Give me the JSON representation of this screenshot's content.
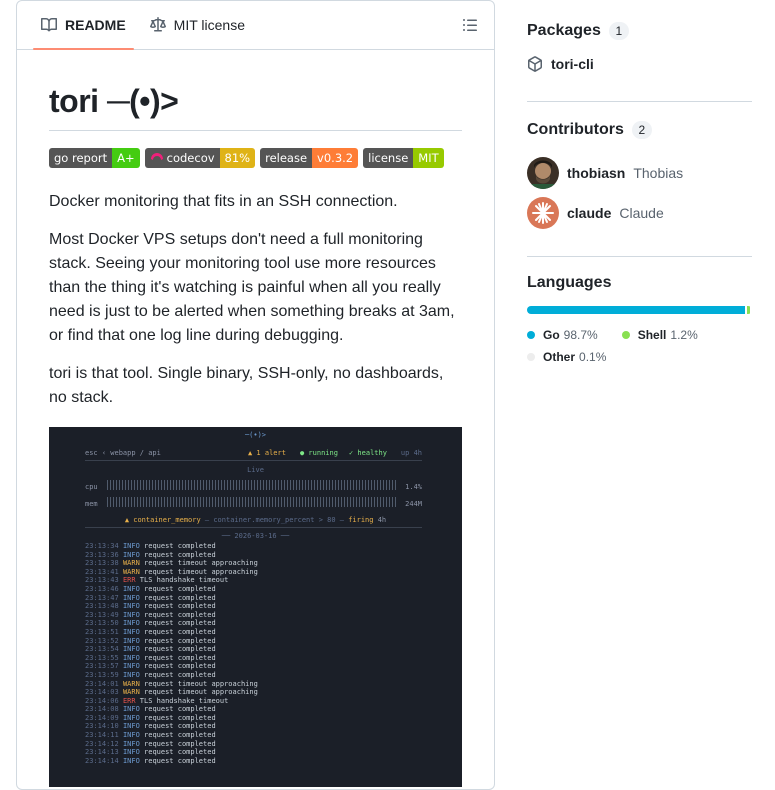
{
  "tabs": [
    {
      "label": "README",
      "icon": "book-icon"
    },
    {
      "label": "MIT license",
      "icon": "law-icon"
    }
  ],
  "readme": {
    "title": "tori ─(•)>",
    "badges": [
      {
        "left": "go report",
        "right": "A+",
        "color": "#4c1"
      },
      {
        "left": "codecov",
        "right": "81%",
        "color": "#dfb317"
      },
      {
        "left": "release",
        "right": "v0.3.2",
        "color": "#fe7d37"
      },
      {
        "left": "license",
        "right": "MIT",
        "color": "#97ca00"
      }
    ],
    "paragraphs": [
      "Docker monitoring that fits in an SSH connection.",
      "Most Docker VPS setups don't need a full monitoring stack. Seeing your monitoring tool use more resources than the thing it's watching is painful when all you really need is just to be alerted when something breaks at 3am, or find that one log line during debugging.",
      "tori is that tool. Single binary, SSH-only, no dashboards, no stack."
    ],
    "terminal": {
      "logo": "─(•)>",
      "breadcrumb": "esc ‹ webapp / api",
      "status_alert": "▲ 1 alert",
      "status_running": "● running",
      "status_healthy": "✓ healthy",
      "status_uptime": "up 4h",
      "live_label": "Live",
      "cpu_label": "cpu",
      "cpu_value": "1.4%",
      "mem_label": "mem",
      "mem_value": "244M",
      "alert_name": "▲ container_memory",
      "alert_rule": "— container.memory_percent > 80 —",
      "alert_state": "firing",
      "alert_age": "4h",
      "date_sep": "── 2026-03-16 ──",
      "logs": [
        {
          "t": "23:13:34",
          "lvl": "INFO",
          "msg": "request completed"
        },
        {
          "t": "23:13:36",
          "lvl": "INFO",
          "msg": "request completed"
        },
        {
          "t": "23:13:38",
          "lvl": "WARN",
          "msg": "request timeout approaching"
        },
        {
          "t": "23:13:41",
          "lvl": "WARN",
          "msg": "request timeout approaching"
        },
        {
          "t": "23:13:43",
          "lvl": "ERR",
          "msg": "TLS handshake timeout"
        },
        {
          "t": "23:13:46",
          "lvl": "INFO",
          "msg": "request completed"
        },
        {
          "t": "23:13:47",
          "lvl": "INFO",
          "msg": "request completed"
        },
        {
          "t": "23:13:48",
          "lvl": "INFO",
          "msg": "request completed"
        },
        {
          "t": "23:13:49",
          "lvl": "INFO",
          "msg": "request completed"
        },
        {
          "t": "23:13:50",
          "lvl": "INFO",
          "msg": "request completed"
        },
        {
          "t": "23:13:51",
          "lvl": "INFO",
          "msg": "request completed"
        },
        {
          "t": "23:13:52",
          "lvl": "INFO",
          "msg": "request completed"
        },
        {
          "t": "23:13:54",
          "lvl": "INFO",
          "msg": "request completed"
        },
        {
          "t": "23:13:55",
          "lvl": "INFO",
          "msg": "request completed"
        },
        {
          "t": "23:13:57",
          "lvl": "INFO",
          "msg": "request completed"
        },
        {
          "t": "23:13:59",
          "lvl": "INFO",
          "msg": "request completed"
        },
        {
          "t": "23:14:01",
          "lvl": "WARN",
          "msg": "request timeout approaching"
        },
        {
          "t": "23:14:03",
          "lvl": "WARN",
          "msg": "request timeout approaching"
        },
        {
          "t": "23:14:06",
          "lvl": "ERR",
          "msg": "TLS handshake timeout"
        },
        {
          "t": "23:14:08",
          "lvl": "INFO",
          "msg": "request completed"
        },
        {
          "t": "23:14:09",
          "lvl": "INFO",
          "msg": "request completed"
        },
        {
          "t": "23:14:10",
          "lvl": "INFO",
          "msg": "request completed"
        },
        {
          "t": "23:14:11",
          "lvl": "INFO",
          "msg": "request completed"
        },
        {
          "t": "23:14:12",
          "lvl": "INFO",
          "msg": "request completed"
        },
        {
          "t": "23:14:13",
          "lvl": "INFO",
          "msg": "request completed"
        },
        {
          "t": "23:14:14",
          "lvl": "INFO",
          "msg": "request completed"
        }
      ]
    }
  },
  "sidebar": {
    "packages": {
      "title": "Packages",
      "count": "1",
      "items": [
        "tori-cli"
      ]
    },
    "contributors": {
      "title": "Contributors",
      "count": "2",
      "items": [
        {
          "login": "thobiasn",
          "name": "Thobias"
        },
        {
          "login": "claude",
          "name": "Claude"
        }
      ]
    },
    "languages": {
      "title": "Languages",
      "items": [
        {
          "name": "Go",
          "pct": "98.7%",
          "value": 98.7,
          "color": "#00ADD8"
        },
        {
          "name": "Shell",
          "pct": "1.2%",
          "value": 1.2,
          "color": "#89e051"
        },
        {
          "name": "Other",
          "pct": "0.1%",
          "value": 0.1,
          "color": "#ededed"
        }
      ]
    }
  }
}
